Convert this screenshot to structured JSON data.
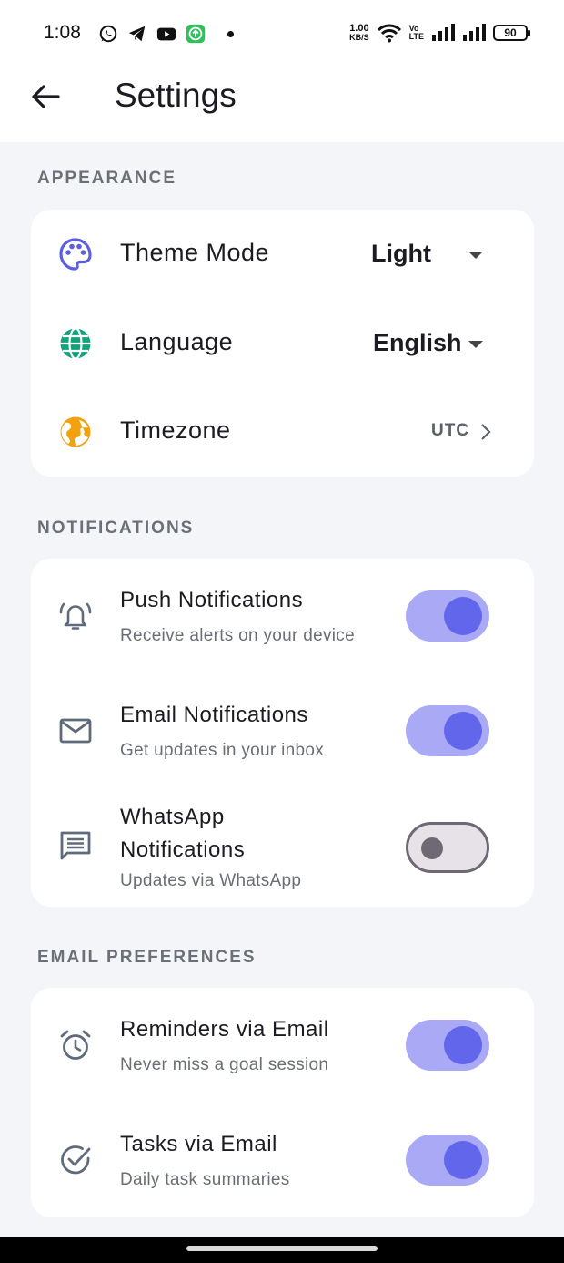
{
  "status_bar": {
    "time": "1:08",
    "net_speed_value": "1.00",
    "net_speed_unit": "KB/S",
    "volte_top": "Vo",
    "volte_bottom": "LTE",
    "battery": "90"
  },
  "app_bar": {
    "title": "Settings"
  },
  "appearance": {
    "section_title": "APPEARANCE",
    "theme_mode": {
      "label": "Theme Mode",
      "value": "Light",
      "icon": "palette-icon",
      "icon_color": "#5b5fe0"
    },
    "language": {
      "label": "Language",
      "value": "English",
      "icon": "globe-icon",
      "icon_color": "#13a37a"
    },
    "timezone": {
      "label": "Timezone",
      "value": "UTC",
      "icon": "earth-icon",
      "icon_color": "#f2a20f"
    }
  },
  "notifications": {
    "section_title": "NOTIFICATIONS",
    "push": {
      "title": "Push Notifications",
      "subtitle": "Receive alerts on your device",
      "enabled": true
    },
    "email": {
      "title": "Email Notifications",
      "subtitle": "Get updates in your inbox",
      "enabled": true
    },
    "whatsapp": {
      "title_line1": "WhatsApp",
      "title_line2": "Notifications",
      "subtitle": "Updates via WhatsApp",
      "enabled": false
    }
  },
  "email_preferences": {
    "section_title": "EMAIL PREFERENCES",
    "reminders": {
      "title": "Reminders via Email",
      "subtitle": "Never miss a goal session",
      "enabled": true
    },
    "tasks": {
      "title": "Tasks via Email",
      "subtitle": "Daily task summaries",
      "enabled": true
    }
  },
  "colors": {
    "accent": "#6166ea",
    "accent_track": "#a9a9f6",
    "icon_gray": "#5f6b7a",
    "background": "#f3f5f8"
  }
}
